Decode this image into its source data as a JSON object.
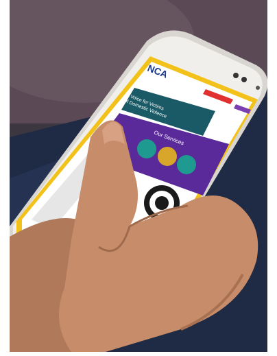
{
  "site": {
    "logo_text": "NCA",
    "hero_headline_line1": "A Voice for Victims",
    "hero_headline_line2": "of Domestic Violence",
    "services_heading": "Our Services"
  },
  "colors": {
    "purple": "#5a2a9a",
    "teal": "#1f9a90",
    "yellow_border": "#f3c21a",
    "red_button": "#e0302f",
    "skin": "#c78d6a"
  }
}
